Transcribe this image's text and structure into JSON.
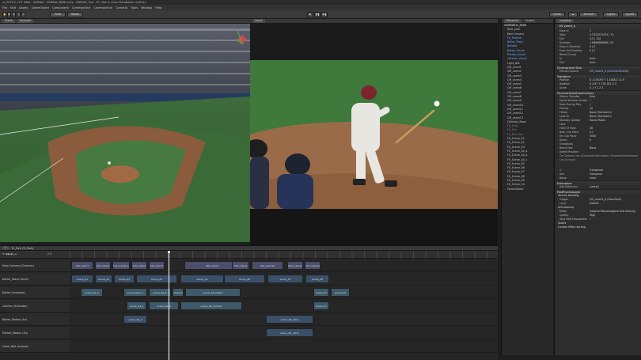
{
  "window": {
    "title": "vt_2019.2.17f1 64bit - UNIMAX - UNIMAX_PANK.unity - UNIMAX_Trial - PC, Mac & Linux Standalone <DX11>"
  },
  "menu": [
    "File",
    "Edit",
    "Assets",
    "GameObject",
    "Component",
    "Cinemachine",
    "Cinemachine",
    "ComeUp",
    "Tools",
    "Window",
    "Help"
  ],
  "toolbar": {
    "pivot_label": "Pivot",
    "global_label": "Global",
    "collab_label": "Collab",
    "account_label": "Account",
    "layers_label": "Layers",
    "layout_label": "Layout"
  },
  "scene_tabs": [
    "Scene",
    "Animator"
  ],
  "game_tabs": [
    "Game"
  ],
  "hierarchy": {
    "tabs": [
      "Hierarchy",
      "Project"
    ],
    "items": [
      {
        "label": "CINEMATIC_PARK",
        "kind": "root"
      },
      {
        "label": "Role_Cam",
        "kind": "normal"
      },
      {
        "label": "Role Camera",
        "kind": "normal"
      },
      {
        "label": "FX_Particle",
        "kind": "blue"
      },
      {
        "label": "Ballet_Track",
        "kind": "blue"
      },
      {
        "label": "Ballebe",
        "kind": "blue"
      },
      {
        "label": "Batter_Visual",
        "kind": "blue"
      },
      {
        "label": "Pitcher_Visual",
        "kind": "blue"
      },
      {
        "label": "Catcher_Visual",
        "kind": "blue"
      },
      {
        "label": "Light_Dot",
        "kind": "normal"
      },
      {
        "label": "CM_vcam1",
        "kind": "normal"
      },
      {
        "label": "CM_vcam2",
        "kind": "normal"
      },
      {
        "label": "CM_vcam3",
        "kind": "normal"
      },
      {
        "label": "CM_vcam4",
        "kind": "normal"
      },
      {
        "label": "CM_vcam5",
        "kind": "normal"
      },
      {
        "label": "CM_vcam6",
        "kind": "normal"
      },
      {
        "label": "CM_vcam7",
        "kind": "normal"
      },
      {
        "label": "CM_vcam8",
        "kind": "normal"
      },
      {
        "label": "CM_vcam9",
        "kind": "normal"
      },
      {
        "label": "CM_vcam10",
        "kind": "normal"
      },
      {
        "label": "CM_vcam11",
        "kind": "normal"
      },
      {
        "label": "CM_vcam12",
        "kind": "normal"
      },
      {
        "label": "CM_vcam13",
        "kind": "normal"
      },
      {
        "label": "Collision_Base",
        "kind": "normal"
      },
      {
        "label": "FX_Dust",
        "kind": "dim"
      },
      {
        "label": "FX_Fire",
        "kind": "dim"
      },
      {
        "label": "FX_Dirt_Hull",
        "kind": "dim"
      },
      {
        "label": "FX_Scene_01",
        "kind": "normal"
      },
      {
        "label": "FX_Scene_02",
        "kind": "normal"
      },
      {
        "label": "FX_Scene_03",
        "kind": "normal"
      },
      {
        "label": "FX_Scene_04_a",
        "kind": "normal"
      },
      {
        "label": "FX_Scene_04_b",
        "kind": "normal"
      },
      {
        "label": "FX_Scene_04_c",
        "kind": "normal"
      },
      {
        "label": "FX_Scene_05",
        "kind": "normal"
      },
      {
        "label": "FX_Scene_06",
        "kind": "normal"
      },
      {
        "label": "FX_Scene_07",
        "kind": "normal"
      },
      {
        "label": "FX_Scene_08",
        "kind": "normal"
      },
      {
        "label": "FX_Scene_09",
        "kind": "normal"
      },
      {
        "label": "FX_Scene_10",
        "kind": "normal"
      },
      {
        "label": "GameObject",
        "kind": "normal"
      }
    ]
  },
  "inspector": {
    "tab": "Inspector",
    "object_name": "CM_vcam4_b",
    "rows_top": [
      {
        "label": "Ease In",
        "value": "1"
      },
      {
        "label": "Start",
        "value": "2.3333333333 | 70"
      },
      {
        "label": "End",
        "value": "4.0 | 120"
      },
      {
        "label": "Duration",
        "value": "1.6666666666 | 50"
      },
      {
        "label": "Ease In Duration",
        "value": "0 | 0"
      },
      {
        "label": "Ease Out Duration",
        "value": "0 | 0"
      },
      {
        "label": "Blend Curves",
        "value": ""
      },
      {
        "label": "In",
        "value": "Auto"
      },
      {
        "label": "Out",
        "value": "Auto"
      }
    ],
    "component_name": "Cinemachine Shot",
    "virtual_camera": {
      "label": "Virtual Camera",
      "value": "CM_vcam4_b (CinemachineVir)"
    },
    "transform": {
      "title": "Transform",
      "rows": [
        {
          "label": "Position",
          "value": "X -4.55097  Y 1.4488  Z 11.9"
        },
        {
          "label": "Rotation",
          "value": "X 4.81  Y 178.781  Z 0"
        },
        {
          "label": "Scale",
          "value": "X 1  Y 1  Z 1"
        }
      ]
    },
    "vcam": {
      "title": "CinemachineVirtualCamera",
      "rows": [
        {
          "label": "Status: Standby",
          "value": "Solo"
        },
        {
          "label": "Game Window Guides",
          "value": "✓"
        },
        {
          "label": "Save During Play",
          "value": "✓"
        },
        {
          "label": "Priority",
          "value": "10"
        },
        {
          "label": "Follow",
          "value": "None (Transform)"
        },
        {
          "label": "Look At",
          "value": "None (Transform)"
        },
        {
          "label": "Standby Update",
          "value": "Round Robin"
        },
        {
          "label": "Lens",
          "value": ""
        },
        {
          "label": "Field Of View",
          "value": "38"
        },
        {
          "label": "Near Clip Plane",
          "value": "0.1"
        },
        {
          "label": "Far Clip Plane",
          "value": "5000"
        },
        {
          "label": "Dutch",
          "value": "0"
        },
        {
          "label": "Transitions",
          "value": ""
        },
        {
          "label": "Blend Hint",
          "value": "None"
        },
        {
          "label": "Inherit Position",
          "value": ""
        }
      ],
      "event_label": "On Camera Live (ICinemachineCamera, ICinemachineCamera)",
      "list_empty": "List is Empty"
    },
    "body": {
      "label": "Body",
      "value": "Transposer"
    },
    "aim": {
      "label": "Aim",
      "value": "Composer"
    },
    "noise": {
      "label": "Noise",
      "value": "none"
    },
    "extensions": {
      "title": "Extensions",
      "add_label": "Add Extension",
      "add_value": "(select)"
    },
    "postprocess": {
      "title": "PostProcessLayer",
      "volume_title": "Volume blending",
      "trigger": {
        "label": "Trigger",
        "value": "CM_vcam4_b (Transform)"
      },
      "layer": {
        "label": "Layer",
        "value": "Default"
      },
      "aa_title": "Anti-aliasing",
      "mode": {
        "label": "Mode",
        "value": "Subpixel Morphological Anti-aliasing"
      },
      "quality": {
        "label": "Quality",
        "value": "High"
      },
      "stop_nan": {
        "label": "Stop NaN Propagation",
        "value": "✓"
      },
      "toolkit": "Toolkit",
      "custom_effect": "Custom Effect Sorting"
    }
  },
  "timeline": {
    "name": "TL_Park (TL_Park)",
    "frame_label": "2.3",
    "tracks": [
      {
        "label": "Main Camera (Cinemac)"
      },
      {
        "label": "Batter_Stand (Anim)"
      },
      {
        "label": "Batter (Animator)"
      },
      {
        "label": "Catcher (Animator)"
      },
      {
        "label": "Batter_Motion (An)"
      },
      {
        "label": "Pitcher_Motion (An)"
      },
      {
        "label": "Catch_Ball (Animat)"
      }
    ],
    "clips": [
      {
        "row": 0,
        "label": "CM_vcam1",
        "color": "purple"
      },
      {
        "row": 0,
        "label": "CM_vcam2",
        "color": "purple"
      },
      {
        "row": 0,
        "label": "CM_vcam4_b",
        "color": "purple"
      },
      {
        "row": 0,
        "label": "CM_vcam6",
        "color": "purple"
      },
      {
        "row": 0,
        "label": "CM_vcam7",
        "color": "purple"
      },
      {
        "row": 0,
        "label": "CM_vcam8",
        "color": "purple"
      },
      {
        "row": 0,
        "label": "CM_vcam9",
        "color": "purple"
      },
      {
        "row": 0,
        "label": "CM_vcam10",
        "color": "purple"
      },
      {
        "row": 0,
        "label": "CM_vcam11",
        "color": "purple"
      },
      {
        "row": 0,
        "label": "CM_vcam12",
        "color": "purple"
      },
      {
        "row": 1,
        "label": "scene_01",
        "color": "blue"
      },
      {
        "row": 1,
        "label": "scene_02",
        "color": "blue"
      },
      {
        "row": 1,
        "label": "scene_03",
        "color": "blue"
      },
      {
        "row": 1,
        "label": "scene_04",
        "color": "blue"
      },
      {
        "row": 1,
        "label": "scene_05",
        "color": "blue"
      },
      {
        "row": 1,
        "label": "scene_06",
        "color": "blue"
      },
      {
        "row": 1,
        "label": "scene_07",
        "color": "blue"
      },
      {
        "row": 1,
        "label": "scene_08",
        "color": "blue"
      },
      {
        "row": 2,
        "label": "scene_01_b",
        "color": "teal"
      },
      {
        "row": 2,
        "label": "scene_04_a_c",
        "color": "teal"
      },
      {
        "row": 2,
        "label": "scene_04_b",
        "color": "teal"
      },
      {
        "row": 2,
        "label": "scene_04_c",
        "color": "teal"
      },
      {
        "row": 2,
        "label": "scene_05_batter",
        "color": "teal"
      },
      {
        "row": 2,
        "label": "scene_07",
        "color": "teal"
      },
      {
        "row": 2,
        "label": "scene_08",
        "color": "teal"
      },
      {
        "row": 3,
        "label": "scene_04_a",
        "color": "teal"
      },
      {
        "row": 3,
        "label": "scene_04_b",
        "color": "teal"
      },
      {
        "row": 3,
        "label": "scene_05_catcher",
        "color": "teal"
      },
      {
        "row": 3,
        "label": "scene_07",
        "color": "teal"
      },
      {
        "row": 4,
        "label": "scene_04_a",
        "color": "blue"
      },
      {
        "row": 4,
        "label": "scene_06_pitch",
        "color": "blue"
      },
      {
        "row": 5,
        "label": "scene_06_catch",
        "color": "blue"
      }
    ]
  },
  "colors": {
    "accent_blue": "#3d6fb6",
    "clip_purple": "#4b4f6a",
    "clip_blue": "#3a5069",
    "playhead": "#ffffff"
  }
}
